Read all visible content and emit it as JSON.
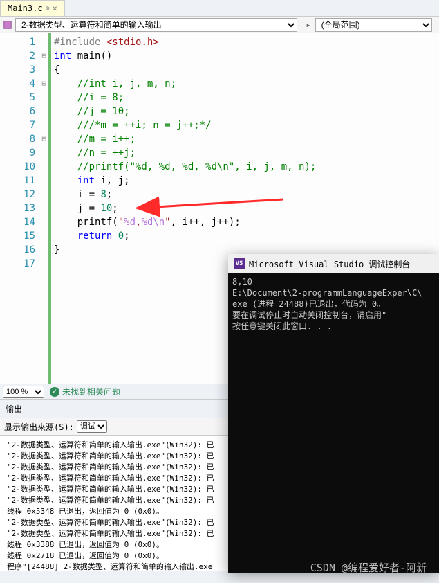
{
  "tab": {
    "name": "Main3.c",
    "pin_icon": "⊕",
    "close_icon": "×"
  },
  "breadcrumb": {
    "left": "2-数据类型、运算符和简单的输入输出",
    "right": "(全局范围)"
  },
  "code": {
    "lines": [
      {
        "n": 1,
        "html": "<span class='pp'>#include</span> <span class='inc'>&lt;stdio.h&gt;</span>"
      },
      {
        "n": 2,
        "html": "<span class='kw'>int</span> <span class='fn'>main</span>()"
      },
      {
        "n": 3,
        "html": "{"
      },
      {
        "n": 4,
        "html": "    <span class='cm'>//int i, j, m, n;</span>"
      },
      {
        "n": 5,
        "html": "    <span class='cm'>//i = 8;</span>"
      },
      {
        "n": 6,
        "html": "    <span class='cm'>//j = 10;</span>"
      },
      {
        "n": 7,
        "html": "    <span class='cm'>///*m = ++i; n = j++;*/</span>"
      },
      {
        "n": 8,
        "html": "    <span class='cm'>//m = i++;</span>"
      },
      {
        "n": 9,
        "html": "    <span class='cm'>//n = ++j;</span>"
      },
      {
        "n": 10,
        "html": "    <span class='cm'>//printf(\"%d, %d, %d, %d\\n\", i, j, m, n);</span>"
      },
      {
        "n": 11,
        "html": ""
      },
      {
        "n": 12,
        "html": "    <span class='kw'>int</span> i, j;"
      },
      {
        "n": 13,
        "html": "    i = <span class='num'>8</span>;"
      },
      {
        "n": 14,
        "html": "    j = <span class='num'>10</span>;"
      },
      {
        "n": 15,
        "html": "    printf(<span class='str'>\"</span><span class='esc'>%d</span><span class='str'>,</span><span class='esc'>%d\\n</span><span class='str'>\"</span>, i++, j++);"
      },
      {
        "n": 16,
        "html": "    <span class='kw'>return</span> <span class='num'>0</span>;"
      },
      {
        "n": 17,
        "html": "}"
      }
    ]
  },
  "zoom": {
    "value": "100 %",
    "status": "未找到相关问题"
  },
  "output": {
    "title": "输出",
    "source_label": "显示输出来源(S):",
    "source_value": "调试",
    "lines": [
      "\"2-数据类型、运算符和简单的输入输出.exe\"(Win32): 已",
      "\"2-数据类型、运算符和简单的输入输出.exe\"(Win32): 已",
      "\"2-数据类型、运算符和简单的输入输出.exe\"(Win32): 已",
      "\"2-数据类型、运算符和简单的输入输出.exe\"(Win32): 已",
      "\"2-数据类型、运算符和简单的输入输出.exe\"(Win32): 已",
      "\"2-数据类型、运算符和简单的输入输出.exe\"(Win32): 已",
      "线程 0x5348 已退出，返回值为 0 (0x0)。",
      "\"2-数据类型、运算符和简单的输入输出.exe\"(Win32): 已",
      "\"2-数据类型、运算符和简单的输入输出.exe\"(Win32): 已",
      "线程 0x3388 已退出，返回值为 0 (0x0)。",
      "线程 0x2718 已退出，返回值为 0 (0x0)。",
      "程序\"[24488] 2-数据类型、运算符和简单的输入输出.exe"
    ]
  },
  "console": {
    "title": "Microsoft Visual Studio 调试控制台",
    "lines": [
      "8,10",
      "",
      "E:\\Document\\2-programmLanguageExper\\C\\",
      "exe (进程 24488)已退出，代码为 0。",
      "要在调试停止时自动关闭控制台，请启用\"",
      "按任意键关闭此窗口. . ."
    ]
  },
  "watermark": "CSDN @编程爱好者-阿新"
}
